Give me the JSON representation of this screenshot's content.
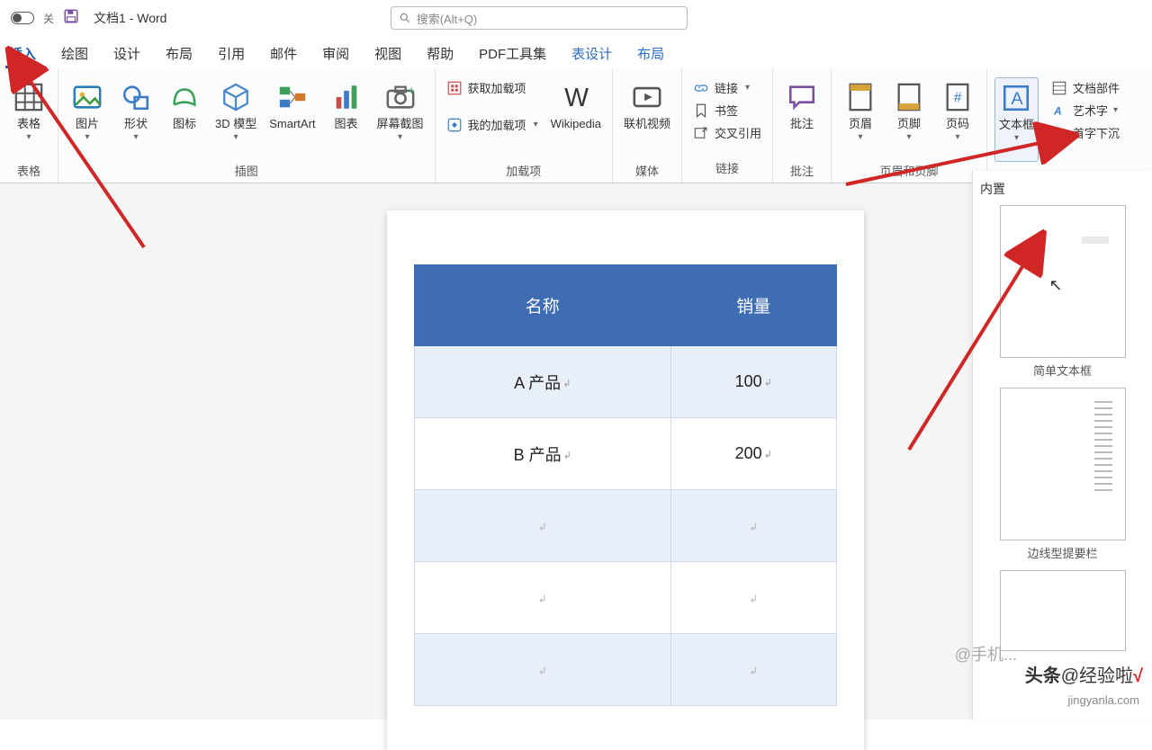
{
  "title": "文档1 - Word",
  "search_placeholder": "搜索(Alt+Q)",
  "tabs": {
    "insert": "插入",
    "draw": "绘图",
    "design": "设计",
    "layout": "布局",
    "ref": "引用",
    "mail": "邮件",
    "review": "审阅",
    "view": "视图",
    "help": "帮助",
    "pdf": "PDF工具集",
    "tdesign": "表设计",
    "tlayout": "布局"
  },
  "ribbon": {
    "table": "表格",
    "picture": "图片",
    "shapes": "形状",
    "icons": "图标",
    "model3d": "3D 模型",
    "smartart": "SmartArt",
    "chart": "图表",
    "screenshot": "屏幕截图",
    "getaddins": "获取加载项",
    "myaddins": "我的加载项",
    "wikipedia": "Wikipedia",
    "onlinevideo": "联机视频",
    "link": "链接",
    "bookmark": "书签",
    "crossref": "交叉引用",
    "comment": "批注",
    "header": "页眉",
    "footer": "页脚",
    "pagenum": "页码",
    "textbox": "文本框",
    "quickparts": "文档部件",
    "wordart": "艺术字",
    "dropcap": "首字下沉"
  },
  "groups": {
    "tables": "表格",
    "illust": "插图",
    "addins": "加载项",
    "media": "媒体",
    "links": "链接",
    "comments": "批注",
    "headerfooter": "页眉和页脚",
    "builtin": "内置"
  },
  "table": {
    "h1": "名称",
    "h2": "销量",
    "r1c1": "A 产品",
    "r1c2": "100",
    "r2c1": "B 产品",
    "r2c2": "200"
  },
  "panel": {
    "title": "内置",
    "opt1": "简单文本框",
    "opt2": "边线型提要栏"
  },
  "watermark": {
    "faint": "@手机...",
    "brand": "头条@经验啦",
    "url": "jingyanla.com"
  }
}
